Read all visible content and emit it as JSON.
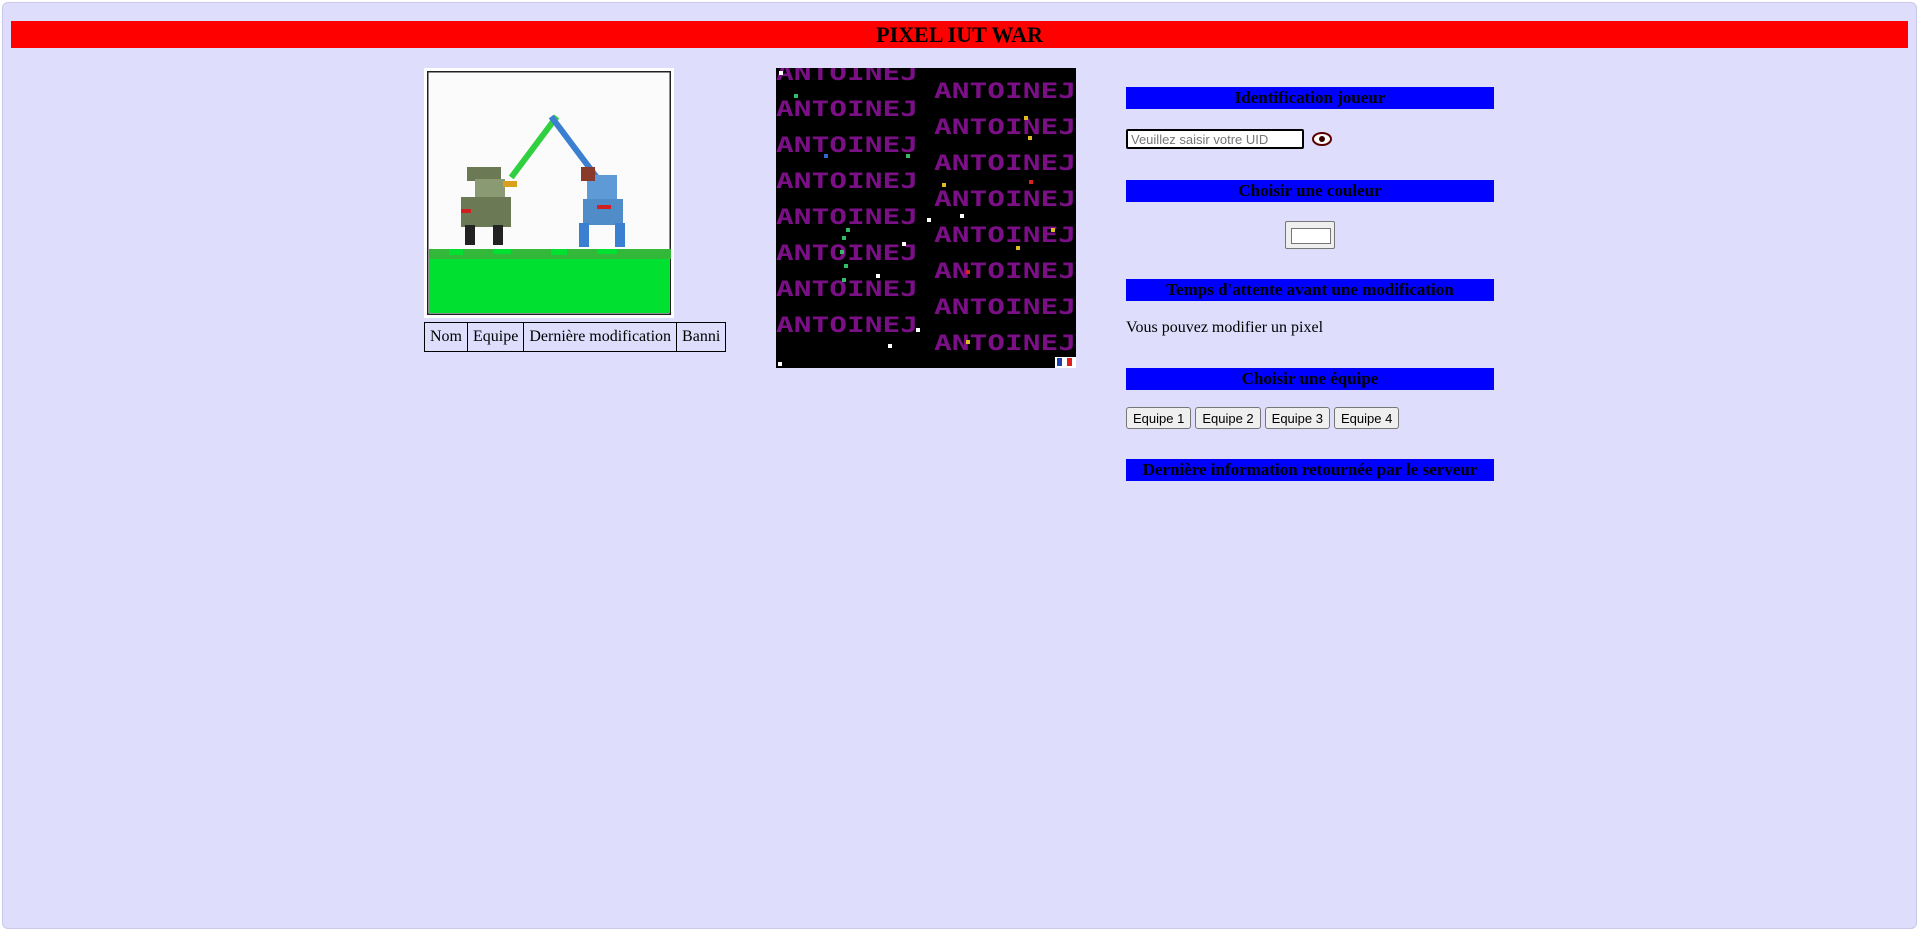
{
  "app": {
    "title": "PIXEL IUT WAR"
  },
  "players_table": {
    "headers": [
      "Nom",
      "Equipe",
      "Dernière modification",
      "Banni"
    ]
  },
  "identification": {
    "title": "Identification joueur",
    "uid_placeholder": "Veuillez saisir votre UID",
    "toggle_icon": "eye-icon"
  },
  "color": {
    "title": "Choisir une couleur",
    "value": "#ffffff"
  },
  "wait": {
    "title": "Temps d'attente avant une modification",
    "message": "Vous pouvez modifier un pixel"
  },
  "teams": {
    "title": "Choisir une équipe",
    "buttons": [
      "Equipe 1",
      "Equipe 2",
      "Equipe 3",
      "Equipe 4"
    ]
  },
  "server": {
    "title": "Dernière information retournée par le serveur"
  },
  "canvas": {
    "repeated_text": "ANTOINEJ",
    "background": "#000000",
    "text_color": "#7a0f86",
    "flag_icon": "french-flag-icon"
  },
  "colors": {
    "banner": "#ff0000",
    "section": "#0000ff",
    "page": "#dedefc"
  }
}
